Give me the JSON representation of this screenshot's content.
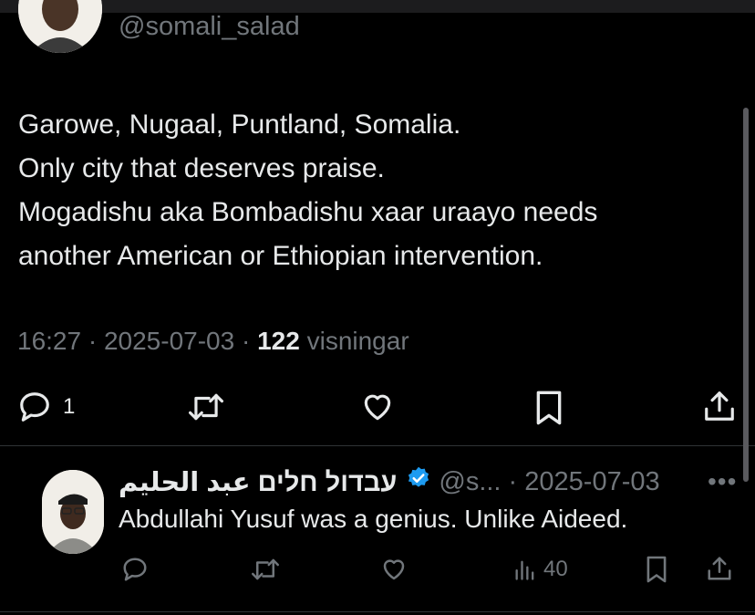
{
  "main_tweet": {
    "handle": "@somali_salad",
    "text_lines": [
      "Garowe, Nugaal, Puntland, Somalia.",
      "Only city that deserves praise.",
      "Mogadishu aka Bombadishu xaar uraayo needs",
      "another American or Ethiopian intervention."
    ],
    "time": "16:27",
    "date": "2025-07-03",
    "separator": " · ",
    "views_count": "122",
    "views_label": " visningar",
    "actions": {
      "reply_count": "1"
    }
  },
  "reply": {
    "display_name": "עבדול חלים عبد الحليم",
    "verified": true,
    "handle": "@s...",
    "date": "2025-07-03",
    "more_label": "•••",
    "text": "Abdullahi Yusuf was a genius. Unlike Aideed.",
    "views_count": "40"
  },
  "colors": {
    "background": "#000000",
    "text_primary": "#e7e9ea",
    "text_secondary": "#71767b",
    "verified_badge": "#1d9bf0",
    "divider": "#2f3336"
  },
  "icons": [
    "reply-icon",
    "retweet-icon",
    "like-icon",
    "bookmark-icon",
    "share-icon",
    "views-icon",
    "verified-badge-icon",
    "more-icon"
  ]
}
